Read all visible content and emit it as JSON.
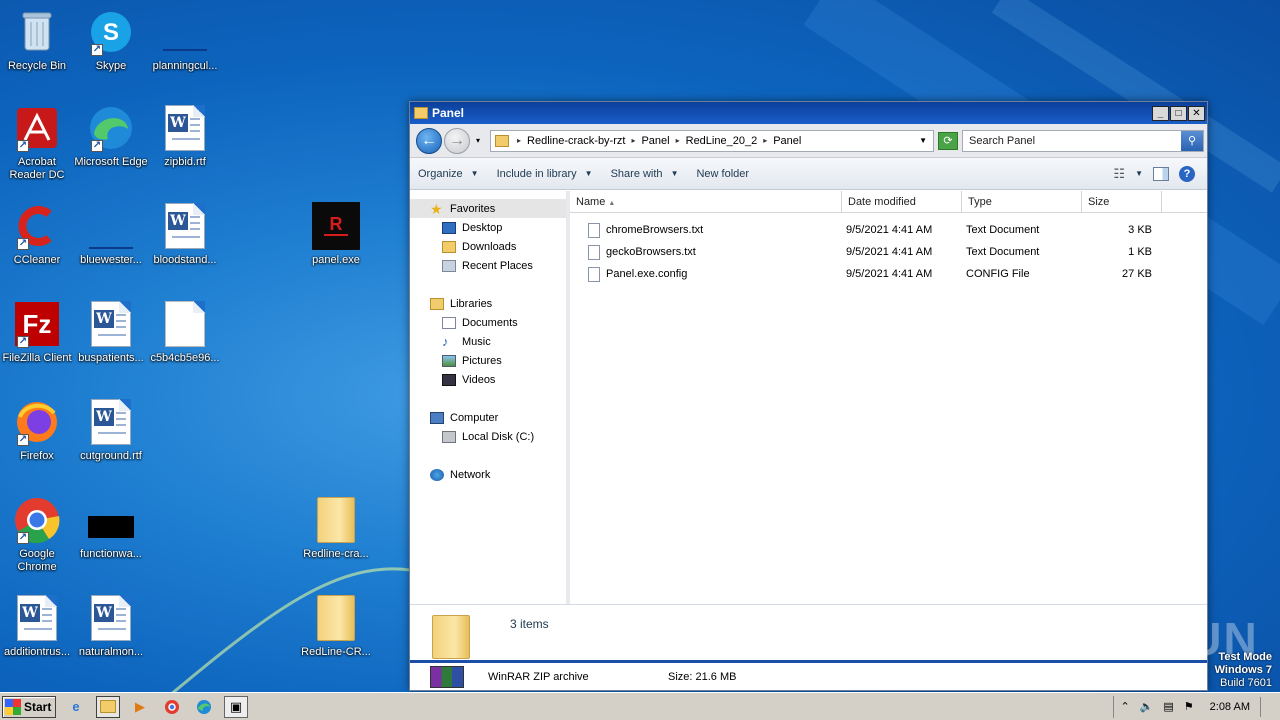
{
  "desktop": {
    "icons": [
      {
        "label": "Recycle Bin"
      },
      {
        "label": "Skype"
      },
      {
        "label": "planningcul..."
      },
      {
        "label": "Acrobat Reader DC"
      },
      {
        "label": "Microsoft Edge"
      },
      {
        "label": "zipbid.rtf"
      },
      {
        "label": "CCleaner"
      },
      {
        "label": "bluewester..."
      },
      {
        "label": "bloodstand..."
      },
      {
        "label": "panel.exe"
      },
      {
        "label": "FileZilla Client"
      },
      {
        "label": "buspatients..."
      },
      {
        "label": "c5b4cb5e96..."
      },
      {
        "label": "Firefox"
      },
      {
        "label": "cutground.rtf"
      },
      {
        "label": "Google Chrome"
      },
      {
        "label": "functionwa..."
      },
      {
        "label": "Redline-cra..."
      },
      {
        "label": "additiontrus..."
      },
      {
        "label": "naturalmon..."
      },
      {
        "label": "RedLine-CR..."
      }
    ]
  },
  "window": {
    "title": "Panel",
    "buttons": {
      "minimize": "_",
      "maximize": "□",
      "close": "✕"
    },
    "address": {
      "crumbs": [
        "Redline-crack-by-rzt",
        "Panel",
        "RedLine_20_2",
        "Panel"
      ]
    },
    "search": {
      "placeholder": "Search Panel"
    },
    "toolbar": {
      "organize": "Organize",
      "include": "Include in library",
      "share": "Share with",
      "new_folder": "New folder"
    },
    "nav": {
      "favorites": "Favorites",
      "desktop": "Desktop",
      "downloads": "Downloads",
      "recent": "Recent Places",
      "libraries": "Libraries",
      "documents": "Documents",
      "music": "Music",
      "pictures": "Pictures",
      "videos": "Videos",
      "computer": "Computer",
      "local_disk": "Local Disk (C:)",
      "network": "Network"
    },
    "columns": {
      "name": "Name",
      "date": "Date modified",
      "type": "Type",
      "size": "Size"
    },
    "files": [
      {
        "name": "chromeBrowsers.txt",
        "date": "9/5/2021 4:41 AM",
        "type": "Text Document",
        "size": "3 KB"
      },
      {
        "name": "geckoBrowsers.txt",
        "date": "9/5/2021 4:41 AM",
        "type": "Text Document",
        "size": "1 KB"
      },
      {
        "name": "Panel.exe.config",
        "date": "9/5/2021 4:41 AM",
        "type": "CONFIG File",
        "size": "27 KB"
      }
    ],
    "details": {
      "count": "3 items"
    },
    "under_window": {
      "type": "WinRAR ZIP archive",
      "size": "Size: 21.6 MB"
    }
  },
  "taskbar": {
    "start": "Start",
    "clock": "2:08 AM"
  },
  "watermark": {
    "line1": "Test Mode",
    "line2": "Windows 7",
    "line3": "Build 7601",
    "brand": "ANY RUN"
  }
}
